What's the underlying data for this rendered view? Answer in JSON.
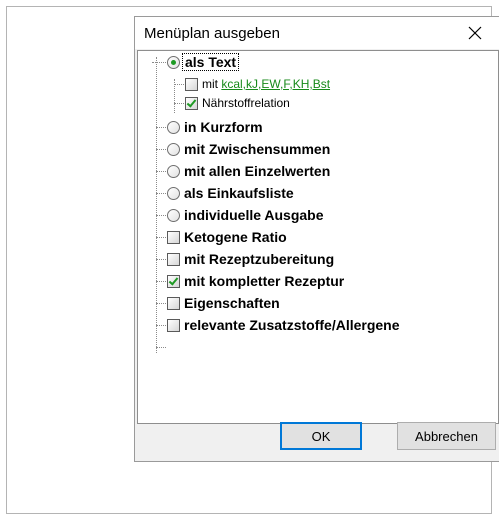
{
  "dialog": {
    "title": "Menüplan ausgeben",
    "close_icon": "close-icon"
  },
  "options": [
    {
      "type": "radio",
      "label": "als Text",
      "checked": true
    },
    {
      "type": "checkbox",
      "label_prefix": "mit ",
      "link": "kcal,kJ,EW,F,KH,Bst",
      "checked": false
    },
    {
      "type": "checkbox",
      "label": "Nährstoffrelation",
      "checked": true
    },
    {
      "type": "radio",
      "label": "in Kurzform",
      "checked": false
    },
    {
      "type": "radio",
      "label": "mit Zwischensummen",
      "checked": false
    },
    {
      "type": "radio",
      "label": "mit allen Einzelwerten",
      "checked": false
    },
    {
      "type": "radio",
      "label": "als Einkaufsliste",
      "checked": false
    },
    {
      "type": "radio",
      "label": "individuelle Ausgabe",
      "checked": false
    },
    {
      "type": "checkbox",
      "label": "Ketogene Ratio",
      "checked": false
    },
    {
      "type": "checkbox",
      "label": "mit Rezeptzubereitung",
      "checked": false
    },
    {
      "type": "checkbox",
      "label": "mit kompletter Rezeptur",
      "checked": true
    },
    {
      "type": "checkbox",
      "label": "Eigenschaften",
      "checked": false
    },
    {
      "type": "checkbox",
      "label": "relevante Zusatzstoffe/Allergene",
      "checked": false
    }
  ],
  "buttons": {
    "ok": "OK",
    "cancel": "Abbrechen"
  },
  "colors": {
    "accent_green": "#178a1a",
    "default_button_border": "#0078d7"
  }
}
